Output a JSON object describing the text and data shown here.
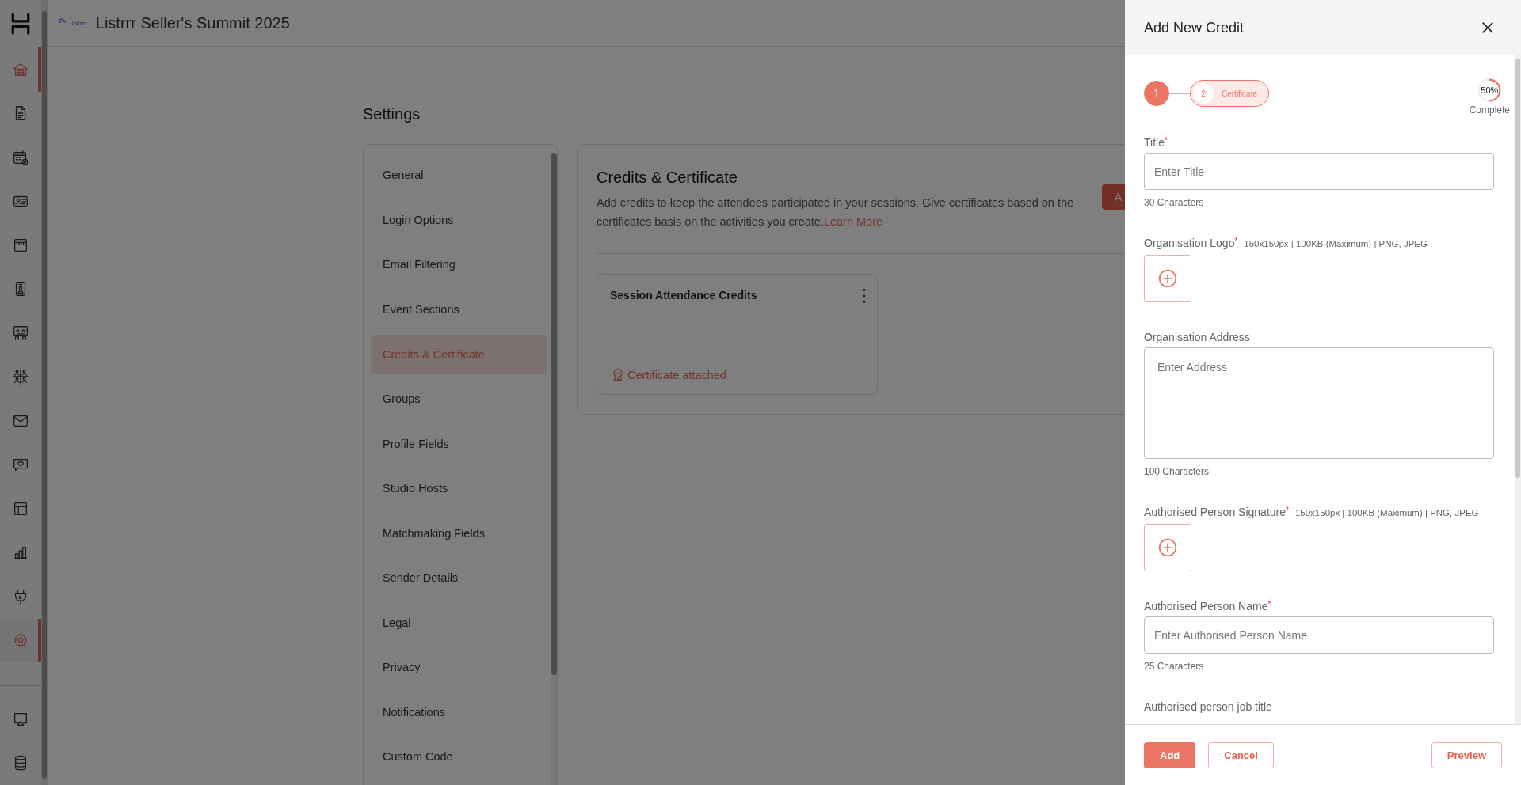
{
  "app_bar": {
    "logo_text": "listrrr",
    "event_title": "Listrrr Seller's Summit 2025"
  },
  "rail": {
    "items": [
      {
        "kind": "building",
        "selected": true
      },
      {
        "kind": "document",
        "selected": false
      },
      {
        "kind": "calendar",
        "selected": false
      },
      {
        "kind": "id-card",
        "selected": false
      },
      {
        "kind": "store",
        "selected": false
      },
      {
        "kind": "badge",
        "selected": false
      },
      {
        "kind": "meeting",
        "selected": false
      },
      {
        "kind": "people",
        "selected": false
      },
      {
        "kind": "mail",
        "selected": false
      },
      {
        "kind": "chat-heart",
        "selected": false
      },
      {
        "kind": "layout",
        "selected": false
      },
      {
        "kind": "chart",
        "selected": false
      },
      {
        "kind": "plug",
        "selected": false
      },
      {
        "kind": "gear",
        "selected": true
      }
    ],
    "bottom_items": [
      {
        "kind": "screen",
        "selected": false
      },
      {
        "kind": "database",
        "selected": false
      }
    ]
  },
  "settings": {
    "title": "Settings",
    "nav": [
      {
        "label": "General",
        "selected": false
      },
      {
        "label": "Login Options",
        "selected": false
      },
      {
        "label": "Email Filtering",
        "selected": false
      },
      {
        "label": "Event Sections",
        "selected": false
      },
      {
        "label": "Credits & Certificate",
        "selected": true
      },
      {
        "label": "Groups",
        "selected": false
      },
      {
        "label": "Profile Fields",
        "selected": false
      },
      {
        "label": "Studio Hosts",
        "selected": false
      },
      {
        "label": "Matchmaking Fields",
        "selected": false
      },
      {
        "label": "Sender Details",
        "selected": false
      },
      {
        "label": "Legal",
        "selected": false
      },
      {
        "label": "Privacy",
        "selected": false
      },
      {
        "label": "Notifications",
        "selected": false
      },
      {
        "label": "Custom Code",
        "selected": false
      }
    ]
  },
  "section": {
    "title": "Credits & Certificate",
    "description": "Add credits to keep the attendees participated in your sessions. Give certificates based on the certificates basis on the activities you create.",
    "link": "Learn More",
    "action_button": "A",
    "credits": [
      {
        "title": "Session Attendance Credits",
        "certificate": "Certificate attached"
      }
    ]
  },
  "drawer": {
    "title": "Add New Credit",
    "steps": [
      {
        "number": "1",
        "completed": true,
        "current": false
      },
      {
        "number": "2",
        "label": "Certificate",
        "completed": false,
        "current": true
      }
    ],
    "progress": {
      "level": 0.5,
      "reading": "50%",
      "caption": "Complete"
    },
    "fields": [
      {
        "kind": "text",
        "label": "Title",
        "required_mark": "*",
        "placeholder": "Enter Title",
        "counter": "30 Characters"
      },
      {
        "kind": "upload",
        "label": "Organisation Logo",
        "required_mark": "*",
        "hint": "150x150px | 100KB (Maximum) | PNG, JPEG"
      },
      {
        "kind": "textarea",
        "label": "Organisation Address",
        "placeholder": "Enter Address",
        "counter": "100 Characters"
      },
      {
        "kind": "upload",
        "label": "Authorised Person Signature",
        "required_mark": "*",
        "hint": "150x150px | 100KB (Maximum) | PNG, JPEG"
      },
      {
        "kind": "text",
        "label": "Authorised Person Name",
        "required_mark": "*",
        "placeholder": "Enter Authorised Person Name",
        "counter": "25 Characters"
      },
      {
        "kind": "label",
        "label": "Authorised person job title"
      }
    ],
    "buttons": [
      {
        "label": "Add",
        "kind": "primary"
      },
      {
        "label": "Cancel",
        "kind": "secondary"
      },
      {
        "label": "Preview",
        "kind": "aside"
      }
    ]
  }
}
